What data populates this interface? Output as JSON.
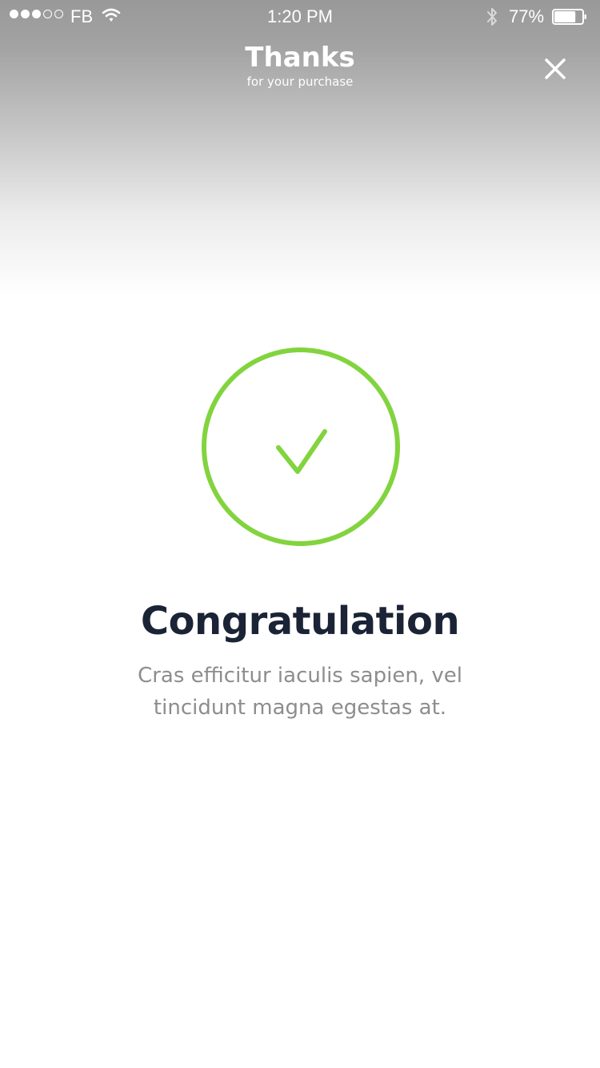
{
  "status_bar": {
    "carrier": "FB",
    "time": "1:20 PM",
    "battery_percent": "77%",
    "battery_level": 0.77,
    "signal_strength": 3,
    "signal_max": 5
  },
  "nav": {
    "title": "Thanks",
    "subtitle": "for your purchase",
    "close_icon": "close-icon"
  },
  "success": {
    "icon": "checkmark-icon",
    "accent_color": "#82d43e",
    "title": "Congratulation",
    "message": "Cras efficitur iaculis sapien, vel tincidunt magna egestas at."
  }
}
